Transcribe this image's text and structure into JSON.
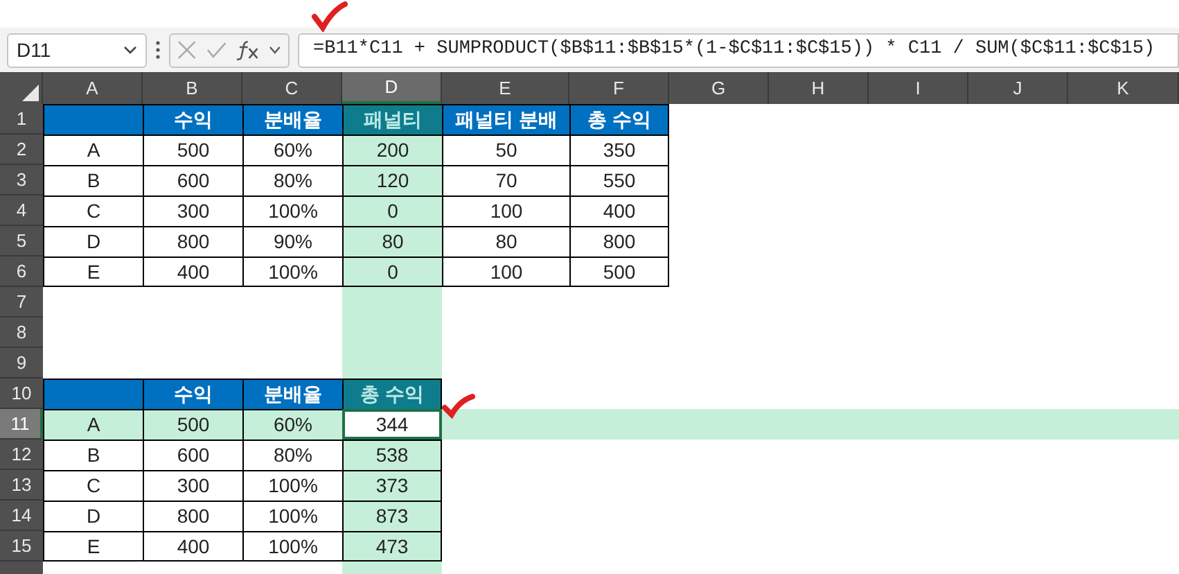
{
  "name_box": "D11",
  "formula": "=B11*C11 + SUMPRODUCT($B$11:$B$15*(1-$C$11:$C$15)) * C11 / SUM($C$11:$C$15)",
  "columns": [
    {
      "label": "A",
      "selected": false
    },
    {
      "label": "B",
      "selected": false
    },
    {
      "label": "C",
      "selected": false
    },
    {
      "label": "D",
      "selected": true
    },
    {
      "label": "E",
      "selected": false
    },
    {
      "label": "F",
      "selected": false
    },
    {
      "label": "G",
      "selected": false
    },
    {
      "label": "H",
      "selected": false
    },
    {
      "label": "I",
      "selected": false
    },
    {
      "label": "J",
      "selected": false
    },
    {
      "label": "K",
      "selected": false
    }
  ],
  "rows": [
    {
      "number": "1",
      "selected": false,
      "cells": [
        {
          "kind": "header"
        },
        {
          "kind": "header",
          "text": "수익"
        },
        {
          "kind": "header",
          "text": "분배율"
        },
        {
          "kind": "header",
          "text": "패널티"
        },
        {
          "kind": "header",
          "text": "패널티 분배"
        },
        {
          "kind": "header",
          "text": "총 수익"
        }
      ]
    },
    {
      "number": "2",
      "selected": false,
      "cells": [
        {
          "kind": "data",
          "text": "A"
        },
        {
          "kind": "data",
          "text": "500"
        },
        {
          "kind": "data",
          "text": "60%"
        },
        {
          "kind": "data",
          "text": "200"
        },
        {
          "kind": "data",
          "text": "50"
        },
        {
          "kind": "data",
          "text": "350"
        }
      ]
    },
    {
      "number": "3",
      "selected": false,
      "cells": [
        {
          "kind": "data",
          "text": "B"
        },
        {
          "kind": "data",
          "text": "600"
        },
        {
          "kind": "data",
          "text": "80%"
        },
        {
          "kind": "data",
          "text": "120"
        },
        {
          "kind": "data",
          "text": "70"
        },
        {
          "kind": "data",
          "text": "550"
        }
      ]
    },
    {
      "number": "4",
      "selected": false,
      "cells": [
        {
          "kind": "data",
          "text": "C"
        },
        {
          "kind": "data",
          "text": "300"
        },
        {
          "kind": "data",
          "text": "100%"
        },
        {
          "kind": "data",
          "text": "0"
        },
        {
          "kind": "data",
          "text": "100"
        },
        {
          "kind": "data",
          "text": "400"
        }
      ]
    },
    {
      "number": "5",
      "selected": false,
      "cells": [
        {
          "kind": "data",
          "text": "D"
        },
        {
          "kind": "data",
          "text": "800"
        },
        {
          "kind": "data",
          "text": "90%"
        },
        {
          "kind": "data",
          "text": "80"
        },
        {
          "kind": "data",
          "text": "80"
        },
        {
          "kind": "data",
          "text": "800"
        }
      ]
    },
    {
      "number": "6",
      "selected": false,
      "cells": [
        {
          "kind": "data",
          "text": "E"
        },
        {
          "kind": "data",
          "text": "400"
        },
        {
          "kind": "data",
          "text": "100%"
        },
        {
          "kind": "data",
          "text": "0"
        },
        {
          "kind": "data",
          "text": "100"
        },
        {
          "kind": "data",
          "text": "500"
        }
      ]
    },
    {
      "number": "7",
      "selected": false,
      "cells": []
    },
    {
      "number": "8",
      "selected": false,
      "cells": []
    },
    {
      "number": "9",
      "selected": false,
      "cells": []
    },
    {
      "number": "10",
      "selected": false,
      "cells": [
        {
          "kind": "header"
        },
        {
          "kind": "header",
          "text": "수익"
        },
        {
          "kind": "header",
          "text": "분배율"
        },
        {
          "kind": "header",
          "text": "총 수익"
        }
      ]
    },
    {
      "number": "11",
      "selected": true,
      "cells": [
        {
          "kind": "data",
          "text": "A"
        },
        {
          "kind": "data",
          "text": "500"
        },
        {
          "kind": "data",
          "text": "60%"
        },
        {
          "kind": "data",
          "text": "344",
          "active": true
        }
      ]
    },
    {
      "number": "12",
      "selected": false,
      "cells": [
        {
          "kind": "data",
          "text": "B"
        },
        {
          "kind": "data",
          "text": "600"
        },
        {
          "kind": "data",
          "text": "80%"
        },
        {
          "kind": "data",
          "text": "538"
        }
      ]
    },
    {
      "number": "13",
      "selected": false,
      "cells": [
        {
          "kind": "data",
          "text": "C"
        },
        {
          "kind": "data",
          "text": "300"
        },
        {
          "kind": "data",
          "text": "100%"
        },
        {
          "kind": "data",
          "text": "373"
        }
      ]
    },
    {
      "number": "14",
      "selected": false,
      "cells": [
        {
          "kind": "data",
          "text": "D"
        },
        {
          "kind": "data",
          "text": "800"
        },
        {
          "kind": "data",
          "text": "100%"
        },
        {
          "kind": "data",
          "text": "873"
        }
      ]
    },
    {
      "number": "15",
      "selected": false,
      "cells": [
        {
          "kind": "data",
          "text": "E"
        },
        {
          "kind": "data",
          "text": "400"
        },
        {
          "kind": "data",
          "text": "100%"
        },
        {
          "kind": "data",
          "text": "473"
        }
      ]
    }
  ]
}
